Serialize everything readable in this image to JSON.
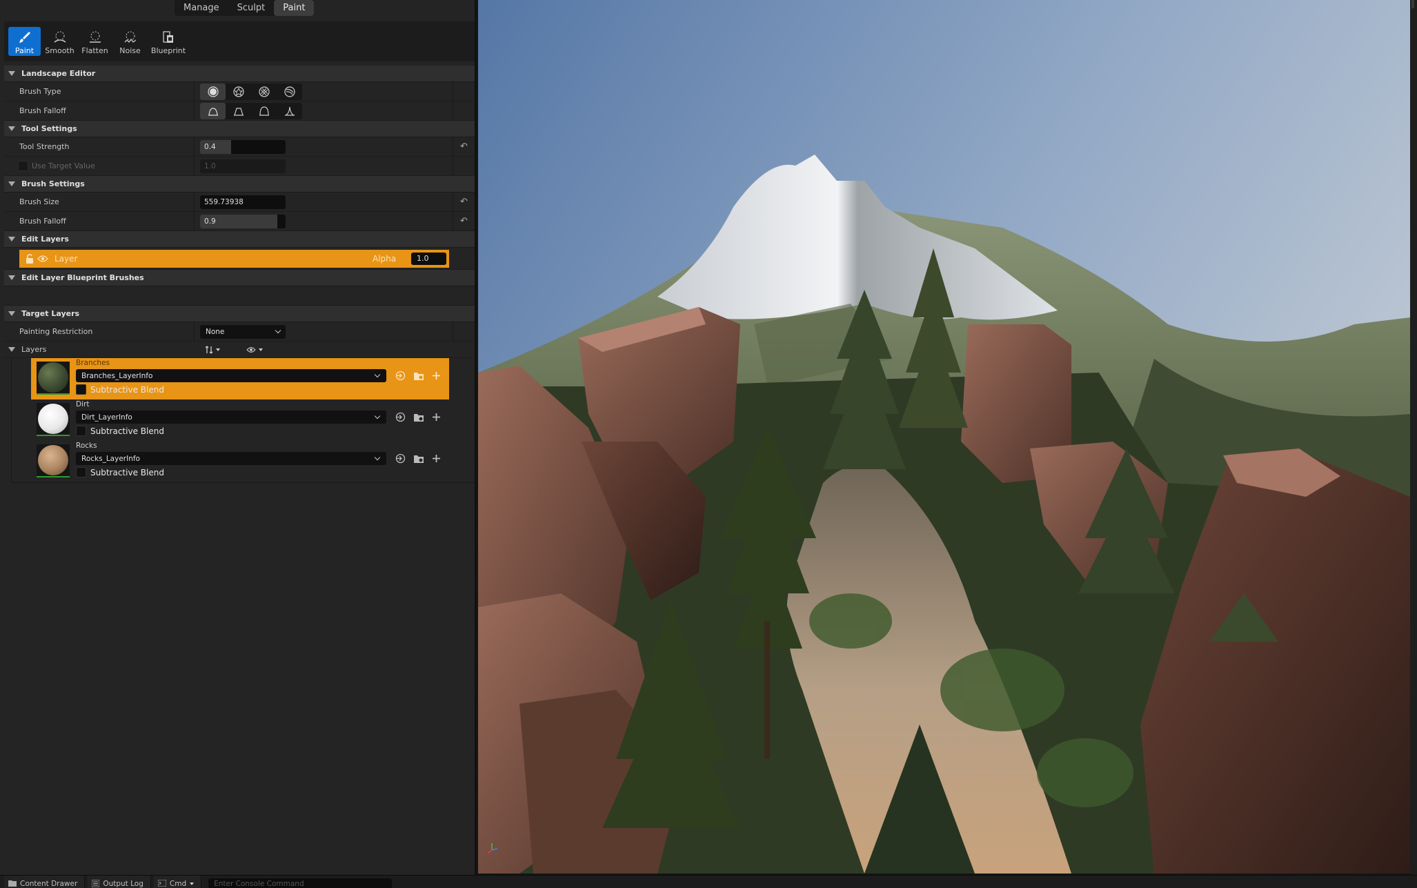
{
  "modes": {
    "tabs": [
      "Manage",
      "Sculpt",
      "Paint"
    ],
    "active": "Paint"
  },
  "tools": [
    {
      "label": "Paint",
      "icon": "paint-brush-icon",
      "active": true
    },
    {
      "label": "Smooth",
      "icon": "smooth-icon",
      "active": false
    },
    {
      "label": "Flatten",
      "icon": "flatten-icon",
      "active": false
    },
    {
      "label": "Noise",
      "icon": "noise-icon",
      "active": false
    },
    {
      "label": "Blueprint",
      "icon": "blueprint-icon",
      "active": false
    }
  ],
  "landscape_editor": {
    "title": "Landscape Editor",
    "brush_type_label": "Brush Type",
    "brush_falloff_label": "Brush Falloff"
  },
  "tool_settings": {
    "title": "Tool Settings",
    "tool_strength_label": "Tool Strength",
    "tool_strength": "0.4",
    "tool_strength_fraction": 0.4,
    "use_target_value_label": "Use Target Value",
    "target_value": "1.0"
  },
  "brush_settings": {
    "title": "Brush Settings",
    "brush_size_label": "Brush Size",
    "brush_size": "559.73938",
    "brush_falloff_label": "Brush Falloff",
    "brush_falloff": "0.9",
    "brush_falloff_fraction": 0.9
  },
  "edit_layers": {
    "title": "Edit Layers",
    "layer_name": "Layer",
    "alpha_label": "Alpha",
    "alpha_value": "1.0"
  },
  "edit_layer_blueprint_brushes": {
    "title": "Edit Layer Blueprint Brushes"
  },
  "target_layers": {
    "title": "Target Layers",
    "painting_restriction_label": "Painting Restriction",
    "painting_restriction": "None",
    "layers_label": "Layers",
    "items": [
      {
        "name": "Branches",
        "layer_info": "Branches_LayerInfo",
        "subtractive_label": "Subtractive Blend",
        "selected": true
      },
      {
        "name": "Dirt",
        "layer_info": "Dirt_LayerInfo",
        "subtractive_label": "Subtractive Blend",
        "selected": false
      },
      {
        "name": "Rocks",
        "layer_info": "Rocks_LayerInfo",
        "subtractive_label": "Subtractive Blend",
        "selected": false
      }
    ]
  },
  "bottom_bar": {
    "content_drawer": "Content Drawer",
    "output_log": "Output Log",
    "cmd": "Cmd",
    "console_placeholder": "Enter Console Command"
  },
  "colors": {
    "accent_orange": "#e89416",
    "active_blue": "#0f6fd1",
    "panel_bg": "#242424"
  }
}
